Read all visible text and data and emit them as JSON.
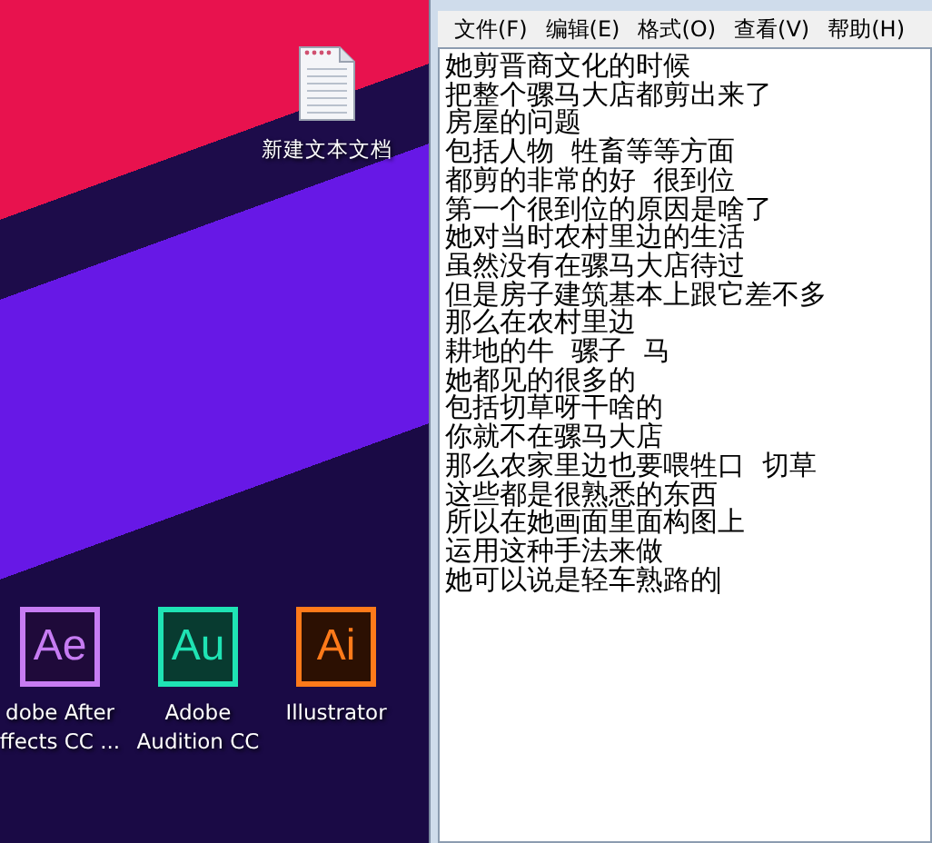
{
  "desktop": {
    "file_icon": {
      "label": "新建文本文档"
    },
    "apps": [
      {
        "kind": "ae",
        "glyph": "Ae",
        "label_lines": [
          "dobe After",
          "ffects CC ..."
        ]
      },
      {
        "kind": "au",
        "glyph": "Au",
        "label_lines": [
          "Adobe",
          "Audition CC"
        ]
      },
      {
        "kind": "ai",
        "glyph": "Ai",
        "label_lines": [
          "Illustrator"
        ]
      }
    ]
  },
  "notepad": {
    "menu": [
      "文件(F)",
      "编辑(E)",
      "格式(O)",
      "查看(V)",
      "帮助(H)"
    ],
    "lines": [
      "她剪晋商文化的时候",
      "把整个骡马大店都剪出来了",
      "房屋的问题",
      "包括人物  牲畜等等方面",
      "都剪的非常的好  很到位",
      "第一个很到位的原因是啥了",
      "她对当时农村里边的生活",
      "虽然没有在骡马大店待过",
      "但是房子建筑基本上跟它差不多",
      "那么在农村里边",
      "耕地的牛  骡子  马",
      "她都见的很多的",
      "包括切草呀干啥的",
      "你就不在骡马大店",
      "那么农家里边也要喂牲口  切草",
      "这些都是很熟悉的东西",
      "所以在她画面里面构图上",
      "运用这种手法来做",
      "她可以说是轻车熟路的"
    ]
  }
}
